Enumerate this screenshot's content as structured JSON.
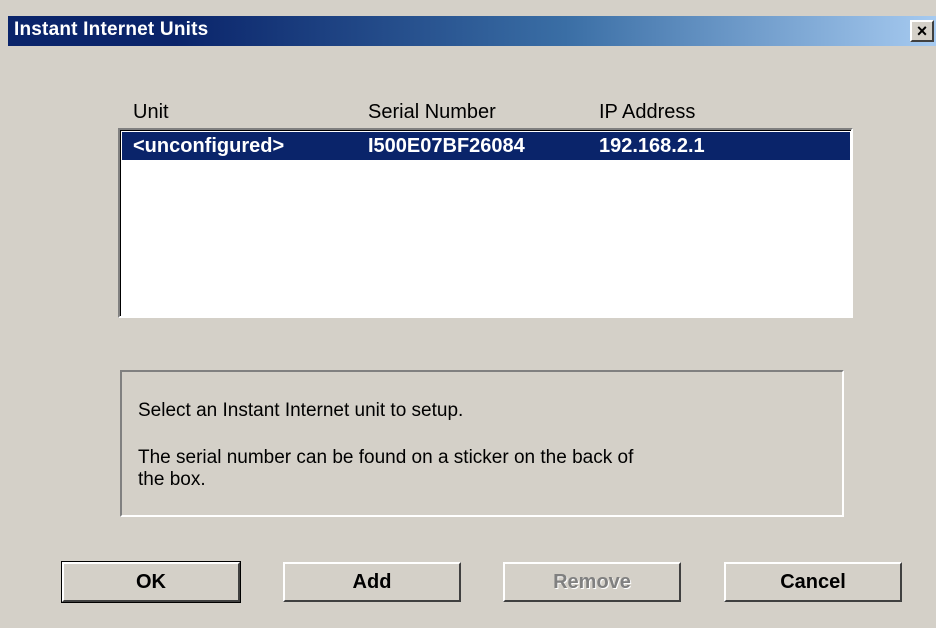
{
  "window": {
    "title": "Instant Internet Units",
    "close_label": "×"
  },
  "list": {
    "headers": {
      "unit": "Unit",
      "serial": "Serial Number",
      "ip": "IP Address"
    },
    "rows": [
      {
        "unit": "<unconfigured>",
        "serial": "I500E07BF26084",
        "ip": "192.168.2.1",
        "selected": true
      }
    ]
  },
  "info": {
    "line1": "Select an Instant Internet unit to setup.",
    "line2": "The serial number can be found on a sticker on the back of",
    "line3": "the box."
  },
  "buttons": {
    "ok": "OK",
    "add": "Add",
    "remove": "Remove",
    "cancel": "Cancel"
  },
  "colors": {
    "selection": "#0a246a",
    "face": "#d4d0c8"
  }
}
